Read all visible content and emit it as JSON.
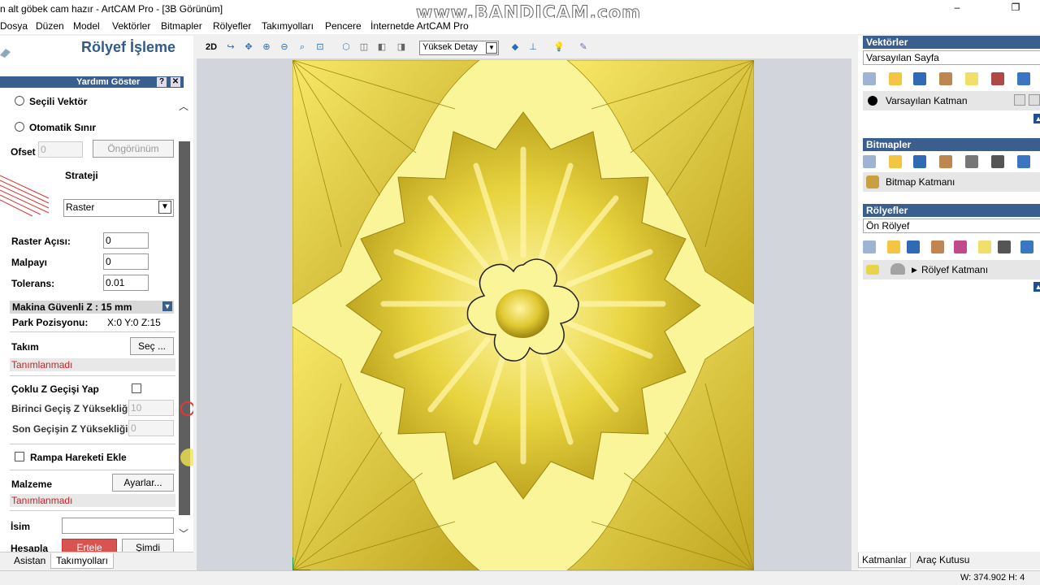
{
  "window": {
    "title": "n alt göbek cam hazır - ArtCAM Pro - [3B Görünüm]",
    "watermark": "www.BANDICAM.com",
    "minimize_glyph": "–",
    "restore_glyph": "❐"
  },
  "menu": [
    "Dosya",
    "Düzen",
    "Model",
    "Vektörler",
    "Bitmapler",
    "Rölyefler",
    "Takımyolları",
    "Pencere",
    "İnternetde ArtCAM Pro"
  ],
  "left_panel": {
    "title": "Rölyef İşleme",
    "help_label": "Yardımı Göster",
    "help_q": "?",
    "help_close": "✕",
    "radio_selected_vector": "Seçili Vektör",
    "radio_auto_boundary": "Otomatik Sınır",
    "offset_label": "Ofset",
    "offset_value": "0",
    "preview_button": "Öngörünüm",
    "strategy_label": "Strateji",
    "strategy_value": "Raster",
    "raster_angle_label": "Raster Açısı:",
    "raster_angle_value": "0",
    "allowance_label": "Malpayı",
    "allowance_value": "0",
    "tolerance_label": "Tolerans:",
    "tolerance_value": "0.01",
    "safe_z_label": "Makina Güvenli Z : 15 mm",
    "park_label": "Park Pozisyonu:",
    "park_value": "X:0 Y:0 Z:15",
    "tool_label": "Takım",
    "tool_button": "Seç ...",
    "tool_status": "Tanımlanmadı",
    "multi_z_label": "Çoklu Z Geçişi Yap",
    "first_pass_label": "Birinci Geçiş Z Yüksekliği",
    "first_pass_value": "10",
    "last_pass_label": "Son Geçişin Z Yüksekliği",
    "last_pass_value": "0",
    "ramp_label": "Rampa Hareketi Ekle",
    "material_label": "Malzeme",
    "material_button": "Ayarlar...",
    "material_status": "Tanımlanmadı",
    "name_label": "İsim",
    "name_value": "",
    "calc_label": "Hesapla",
    "later_button": "Ertele",
    "now_button": "Şimdi",
    "tabs": [
      "Asistan",
      "Takımyolları"
    ]
  },
  "view_toolbar": {
    "mode_2d": "2D",
    "detail_select": "Yüksek Detay"
  },
  "right_panel": {
    "vectors_header": "Vektörler",
    "vectors_sheet": "Varsayılan Sayfa",
    "vectors_layer": "Varsayılan Katman",
    "bitmaps_header": "Bitmapler",
    "bitmap_layer": "Bitmap Katmanı",
    "reliefs_header": "Rölyefler",
    "reliefs_sheet": "Ön Rölyef",
    "relief_layer": "Rölyef Katmanı",
    "tabs": [
      "Katmanlar",
      "Araç Kutusu"
    ]
  },
  "status": {
    "coord": "W: 374.902   H: 4"
  },
  "colors": {
    "panel_header": "#3a5f8f",
    "relief_gold": "#e2cf3a",
    "relief_light": "#fbf59a",
    "viewport_bg": "#d2d6dc"
  }
}
